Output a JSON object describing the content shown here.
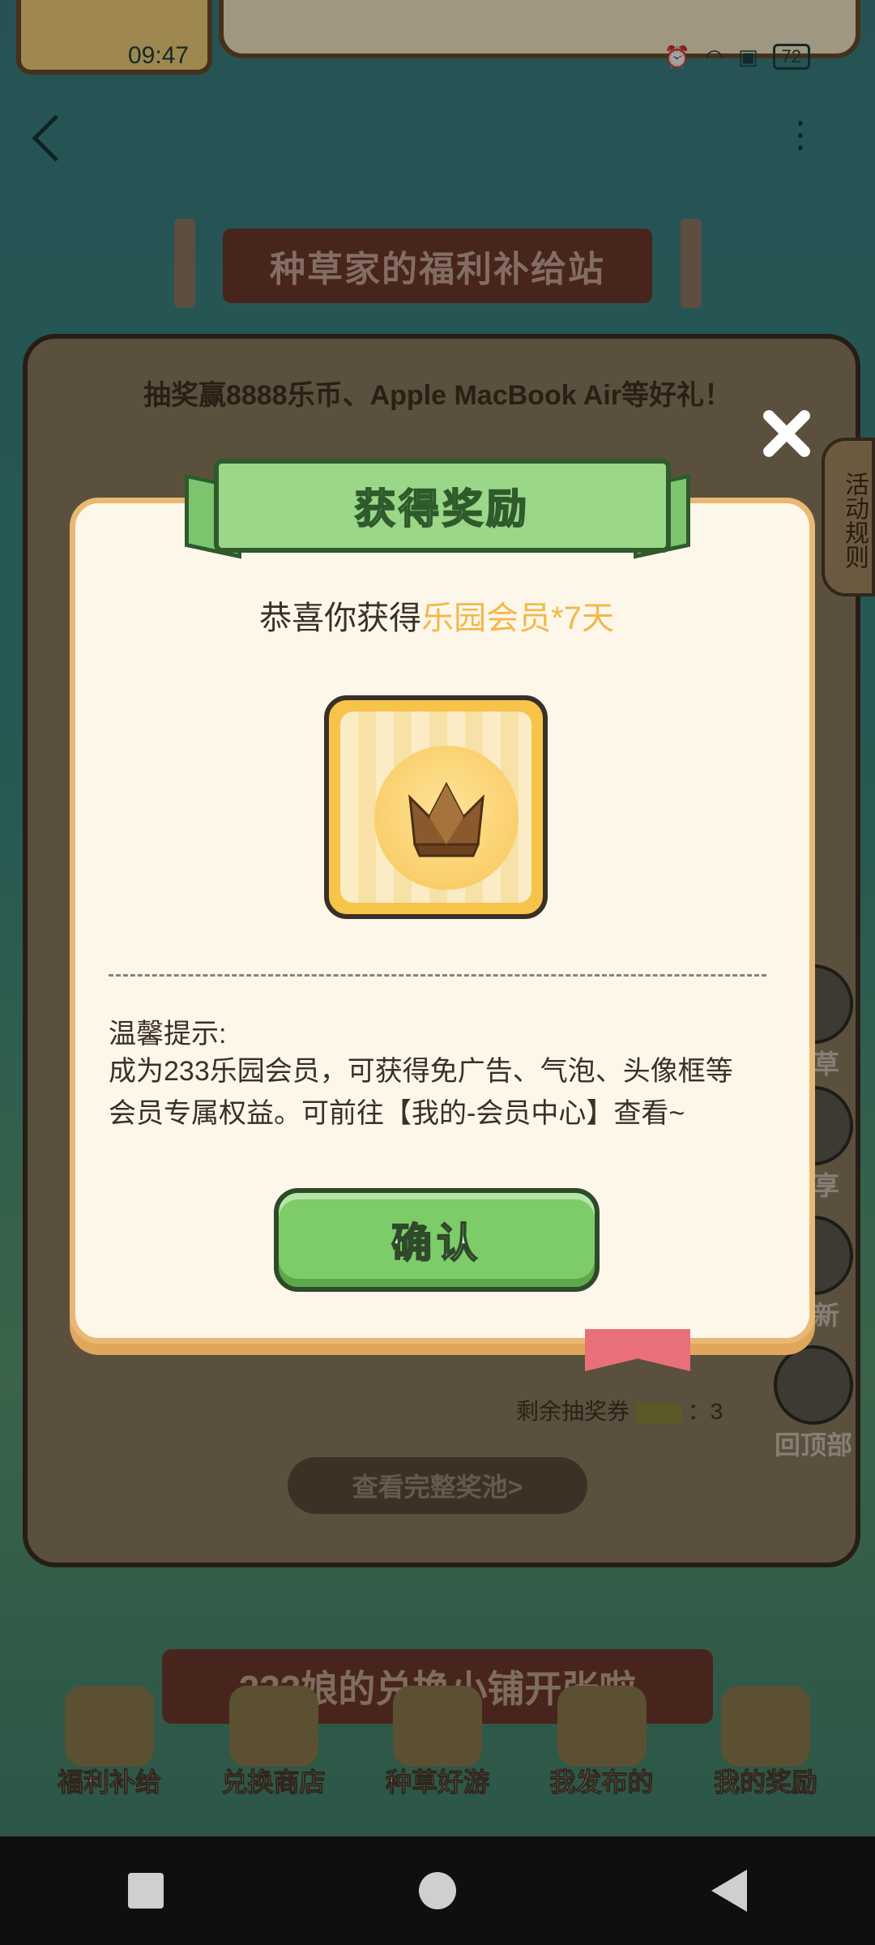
{
  "status_bar": {
    "time": "09:47",
    "battery": "72"
  },
  "background": {
    "sign_title": "种草家的福利补给站",
    "panel_subtitle": "抽奖赢8888乐币、Apple MacBook Air等好礼！",
    "side_rules_tab": "活动规则",
    "side_buttons": [
      "种草",
      "分享",
      "刷新",
      "回顶部"
    ],
    "remaining_label": "剩余抽奖券",
    "remaining_count": "：3",
    "pool_button": "查看完整奖池>",
    "bottom_banner": "233娘的兑换小铺开张啦",
    "bottom_nav": [
      "福利补给",
      "兑换商店",
      "种草好游",
      "我发布的",
      "我的奖励"
    ]
  },
  "modal": {
    "title": "获得奖励",
    "congrats_prefix": "恭喜你获得",
    "congrats_highlight": "乐园会员*7天",
    "reward_icon": "crown-icon",
    "tip_title": "温馨提示:",
    "tip_body": "成为233乐园会员，可获得免广告、气泡、头像框等会员专属权益。可前往【我的-会员中心】查看~",
    "confirm_label": "确认",
    "close_icon": "close-icon"
  },
  "colors": {
    "accent_green": "#7ecb6a",
    "highlight_yellow": "#f3b84c",
    "modal_border": "#e9b874"
  }
}
